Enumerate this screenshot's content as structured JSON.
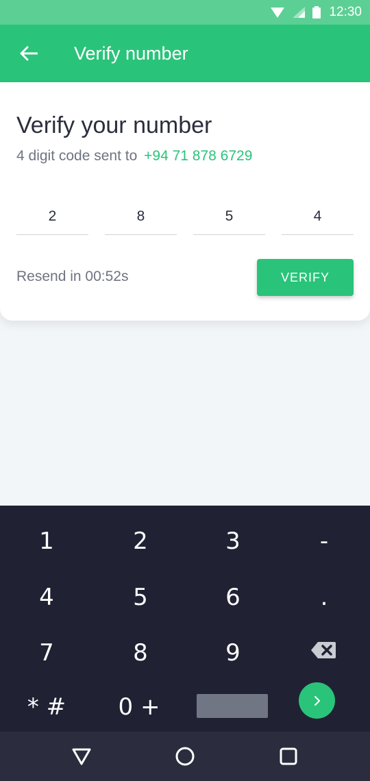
{
  "status_bar": {
    "time": "12:30"
  },
  "app_bar": {
    "title": "Verify number"
  },
  "card": {
    "title": "Verify your number",
    "subtitle_prefix": "4 digit code sent to",
    "phone": "+94 71 878 6729",
    "code_digits": [
      "2",
      "8",
      "5",
      "4"
    ],
    "resend_text": "Resend in 00:52s",
    "verify_label": "VERIFY"
  },
  "keyboard": {
    "rows": [
      [
        "1",
        "2",
        "3",
        "-"
      ],
      [
        "4",
        "5",
        "6",
        "."
      ],
      [
        "7",
        "8",
        "9"
      ],
      [
        "* #",
        "0 +"
      ]
    ],
    "icons": {
      "backspace": "backspace-icon",
      "go": "chevron-right-icon"
    }
  },
  "colors": {
    "accent": "#2ac37a",
    "status_bar": "#5ccf94",
    "keyboard_bg": "#202233"
  }
}
